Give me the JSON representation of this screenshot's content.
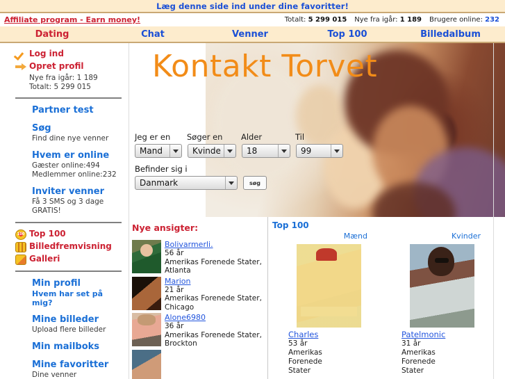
{
  "favbar": {
    "text": "Læg denne side ind under dine favoritter!"
  },
  "statsbar": {
    "affiliate": "Affiliate program - Earn money!",
    "total_label": "Totalt:",
    "total_value": "5 299 015",
    "new_label": "Nye fra igår:",
    "new_value": "1 189",
    "online_label": "Brugere online:",
    "online_value": "232"
  },
  "nav": {
    "items": [
      {
        "label": "Dating",
        "active": true
      },
      {
        "label": "Chat",
        "active": false
      },
      {
        "label": "Venner",
        "active": false
      },
      {
        "label": "Top 100",
        "active": false
      },
      {
        "label": "Billedalbum",
        "active": false
      }
    ]
  },
  "sidebar": {
    "login": "Log ind",
    "create": "Opret profil",
    "new_yesterday": "Nye fra igår: 1 189",
    "total": "Totalt: 5 299 015",
    "partner_test": "Partner test",
    "search": "Søg",
    "search_sub": "Find dine nye venner",
    "who_online": "Hvem er online",
    "guests_online": "Gæster online:494",
    "members_online": "Medlemmer online:232",
    "invite": "Inviter venner",
    "invite_sub1": "Få 3 SMS og 3 dage",
    "invite_sub2": "GRATIS!",
    "top100": "Top 100",
    "slideshow": "Billedfremvisning",
    "gallery": "Galleri",
    "my_profile": "Min profil",
    "my_profile_sub": "Hvem har set på mig?",
    "my_pictures": "Mine billeder",
    "my_pictures_sub": "Upload flere billeder",
    "my_mailbox": "Min mailboks",
    "my_favorites": "Mine favoritter",
    "my_favorites_sub": "Dine venner"
  },
  "banner": {
    "title": "Kontakt Torvet"
  },
  "search_form": {
    "label_iam": "Jeg er en",
    "label_seeking": "Søger en",
    "label_age": "Alder",
    "label_to": "Til",
    "value_iam": "Mand",
    "value_seeking": "Kvinde",
    "value_age": "18",
    "value_to": "99",
    "label_location": "Befinder sig i",
    "value_location": "Danmark",
    "button": "søg"
  },
  "new_faces": {
    "title": "Nye ansigter:",
    "items": [
      {
        "name": "Bolivarmerli.",
        "age": "56 år",
        "country": "Amerikas Forenede Stater,",
        "city": "Atlanta"
      },
      {
        "name": "Marion",
        "age": "21 år",
        "country": "Amerikas Forenede Stater,",
        "city": "Chicago"
      },
      {
        "name": "Alone6980",
        "age": "36 år",
        "country": "Amerikas Forenede Stater,",
        "city": "Brockton"
      },
      {
        "name": "",
        "age": "",
        "country": "",
        "city": ""
      }
    ]
  },
  "top100": {
    "title": "Top 100",
    "columns": [
      {
        "heading": "Mænd",
        "name": "Charles",
        "age": "53 år",
        "country_line1": "Amerikas",
        "country_line2": "Forenede",
        "country_line3": "Stater"
      },
      {
        "heading": "Kvinder",
        "name": "Patelmonic",
        "age": "31 år",
        "country_line1": "Amerikas",
        "country_line2": "Forenede",
        "country_line3": "Stater"
      }
    ]
  },
  "colors": {
    "accent_red": "#cc2233",
    "link_blue": "#1a6fd6",
    "banner_orange": "#f28c18",
    "bar_cream": "#fdeccd",
    "bar_border": "#c9a874"
  }
}
